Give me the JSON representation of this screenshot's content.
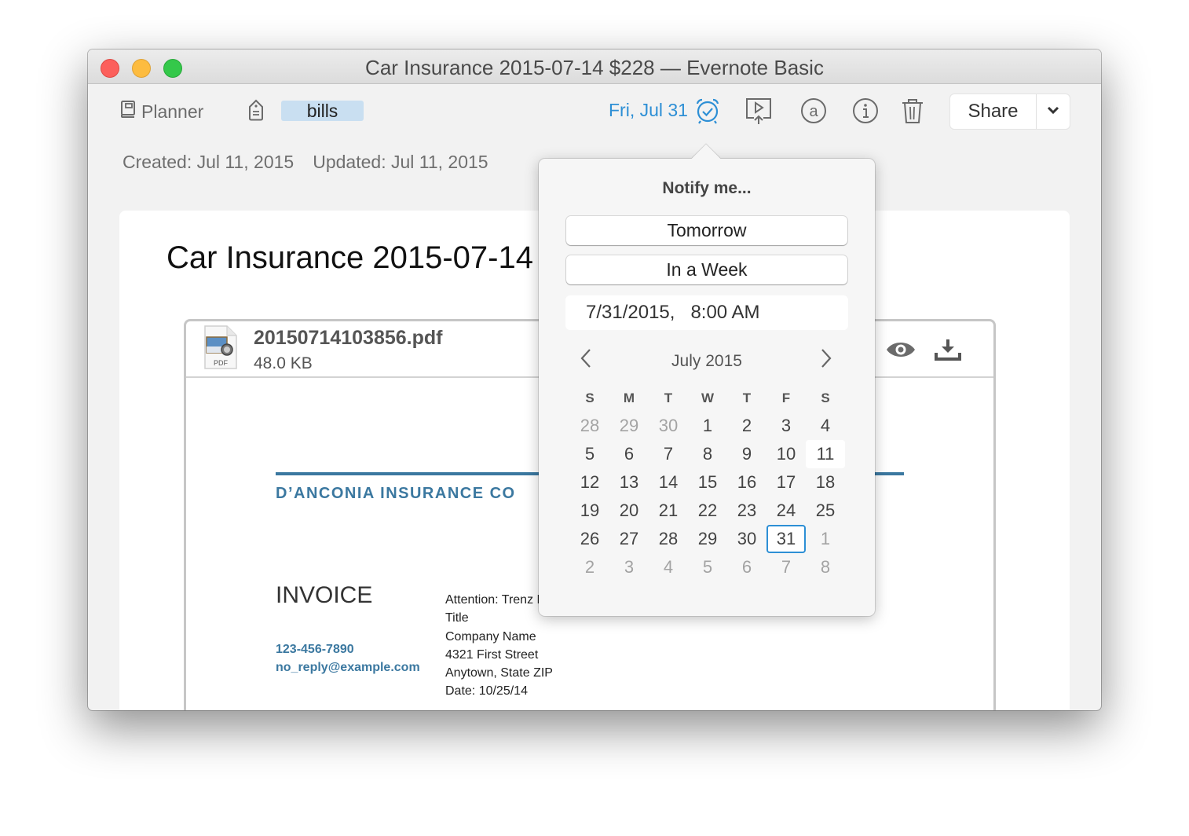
{
  "window": {
    "title": "Car Insurance 2015-07-14 $228 — Evernote Basic"
  },
  "toolbar": {
    "notebook_label": "Planner",
    "tag_label": "bills",
    "reminder_date": "Fri, Jul 31",
    "share_label": "Share",
    "icons": [
      "notebook-icon",
      "tag-icon",
      "alarm-clock-icon",
      "presentation-icon",
      "at-sign-icon",
      "info-icon",
      "trash-icon",
      "chevron-down-icon"
    ]
  },
  "meta": {
    "created": "Created: Jul 11, 2015",
    "updated": "Updated: Jul 11, 2015"
  },
  "note": {
    "title": "Car Insurance 2015-07-14",
    "attachment": {
      "filename": "20150714103856.pdf",
      "size": "48.0 KB",
      "icon_label": "PDF"
    },
    "pdf": {
      "company": "D’ANCONIA INSURANCE CO",
      "heading": "INVOICE",
      "phone": "123-456-7890",
      "email": "no_reply@example.com",
      "address_lines": [
        "Attention: Trenz P",
        "Title",
        "Company Name",
        "4321 First Street",
        "Anytown, State ZIP",
        "Date: 10/25/14"
      ]
    }
  },
  "reminder_popover": {
    "title": "Notify me...",
    "tomorrow_label": "Tomorrow",
    "week_label": "In a Week",
    "date_value": "7/31/2015,",
    "time_value": "8:00 AM",
    "month_label": "July 2015",
    "weekdays": [
      "S",
      "M",
      "T",
      "W",
      "T",
      "F",
      "S"
    ],
    "weeks": [
      [
        {
          "d": "28",
          "o": true
        },
        {
          "d": "29",
          "o": true
        },
        {
          "d": "30",
          "o": true
        },
        {
          "d": "1"
        },
        {
          "d": "2"
        },
        {
          "d": "3"
        },
        {
          "d": "4"
        }
      ],
      [
        {
          "d": "5"
        },
        {
          "d": "6"
        },
        {
          "d": "7"
        },
        {
          "d": "8"
        },
        {
          "d": "9"
        },
        {
          "d": "10"
        },
        {
          "d": "11",
          "today": true
        }
      ],
      [
        {
          "d": "12"
        },
        {
          "d": "13"
        },
        {
          "d": "14"
        },
        {
          "d": "15"
        },
        {
          "d": "16"
        },
        {
          "d": "17"
        },
        {
          "d": "18"
        }
      ],
      [
        {
          "d": "19"
        },
        {
          "d": "20"
        },
        {
          "d": "21"
        },
        {
          "d": "22"
        },
        {
          "d": "23"
        },
        {
          "d": "24"
        },
        {
          "d": "25"
        }
      ],
      [
        {
          "d": "26"
        },
        {
          "d": "27"
        },
        {
          "d": "28"
        },
        {
          "d": "29"
        },
        {
          "d": "30"
        },
        {
          "d": "31",
          "selected": true
        },
        {
          "d": "1",
          "o": true
        }
      ],
      [
        {
          "d": "2",
          "o": true
        },
        {
          "d": "3",
          "o": true
        },
        {
          "d": "4",
          "o": true
        },
        {
          "d": "5",
          "o": true
        },
        {
          "d": "6",
          "o": true
        },
        {
          "d": "7",
          "o": true
        },
        {
          "d": "8",
          "o": true
        }
      ]
    ]
  },
  "colors": {
    "accent": "#2d8fd5",
    "tag_bg": "#c9dff1",
    "brand_blue": "#3b78a0"
  }
}
